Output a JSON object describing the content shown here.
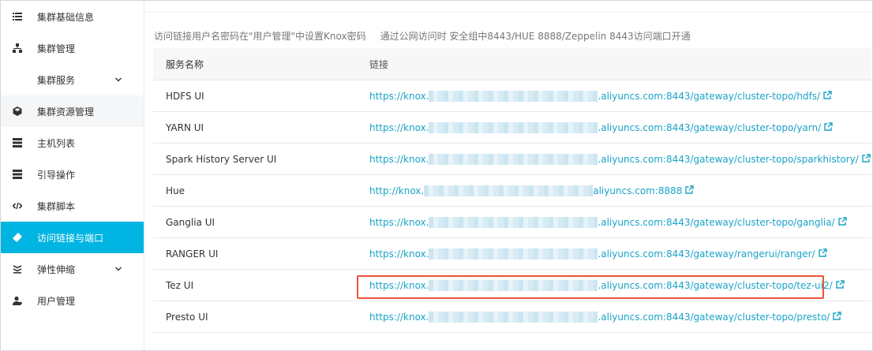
{
  "sidebar": {
    "items": [
      {
        "label": "集群基础信息",
        "icon": "list-icon",
        "chevron": false,
        "state": "normal"
      },
      {
        "label": "集群管理",
        "icon": "cluster-icon",
        "chevron": false,
        "state": "normal"
      },
      {
        "label": "集群服务",
        "icon": "",
        "chevron": true,
        "state": "normal"
      },
      {
        "label": "集群资源管理",
        "icon": "cube-icon",
        "chevron": false,
        "state": "light"
      },
      {
        "label": "主机列表",
        "icon": "server-icon",
        "chevron": false,
        "state": "normal"
      },
      {
        "label": "引导操作",
        "icon": "server-icon",
        "chevron": false,
        "state": "normal"
      },
      {
        "label": "集群脚本",
        "icon": "code-icon",
        "chevron": false,
        "state": "normal"
      },
      {
        "label": "访问链接与端口",
        "icon": "link-icon",
        "chevron": false,
        "state": "active"
      },
      {
        "label": "弹性伸缩",
        "icon": "scale-icon",
        "chevron": true,
        "state": "normal"
      },
      {
        "label": "用户管理",
        "icon": "user-icon",
        "chevron": false,
        "state": "normal"
      }
    ]
  },
  "notice": {
    "part1": "访问链接用户名密码在\"用户管理\"中设置Knox密码",
    "part2": "通过公网访问时 安全组中8443/HUE 8888/Zeppelin  8443访问端口开通"
  },
  "table": {
    "headers": [
      "服务名称",
      "链接"
    ],
    "rows": [
      {
        "service": "HDFS UI",
        "link_prefix": "https://knox.",
        "link_suffix": ".aliyuncs.com:8443/gateway/cluster-topo/hdfs/"
      },
      {
        "service": "YARN UI",
        "link_prefix": "https://knox.",
        "link_suffix": ".aliyuncs.com:8443/gateway/cluster-topo/yarn/"
      },
      {
        "service": "Spark History Server UI",
        "link_prefix": "https://knox.",
        "link_suffix": ".aliyuncs.com:8443/gateway/cluster-topo/sparkhistory/"
      },
      {
        "service": "Hue",
        "link_prefix": "http://knox.",
        "link_suffix": "aliyuncs.com:8888"
      },
      {
        "service": "Ganglia UI",
        "link_prefix": "https://knox.",
        "link_suffix": ".aliyuncs.com:8443/gateway/cluster-topo/ganglia/"
      },
      {
        "service": "RANGER UI",
        "link_prefix": "https://knox.",
        "link_suffix": ".aliyuncs.com:8443/gateway/rangerui/ranger/"
      },
      {
        "service": "Tez UI",
        "link_prefix": "https://knox.",
        "link_suffix": ".aliyuncs.com:8443/gateway/cluster-topo/tez-ui2/"
      },
      {
        "service": "Presto UI",
        "link_prefix": "https://knox.",
        "link_suffix": ".aliyuncs.com:8443/gateway/cluster-topo/presto/"
      }
    ]
  },
  "colors": {
    "accent": "#00b5e2",
    "link": "#1aa3c8",
    "highlight": "#e8553a"
  }
}
